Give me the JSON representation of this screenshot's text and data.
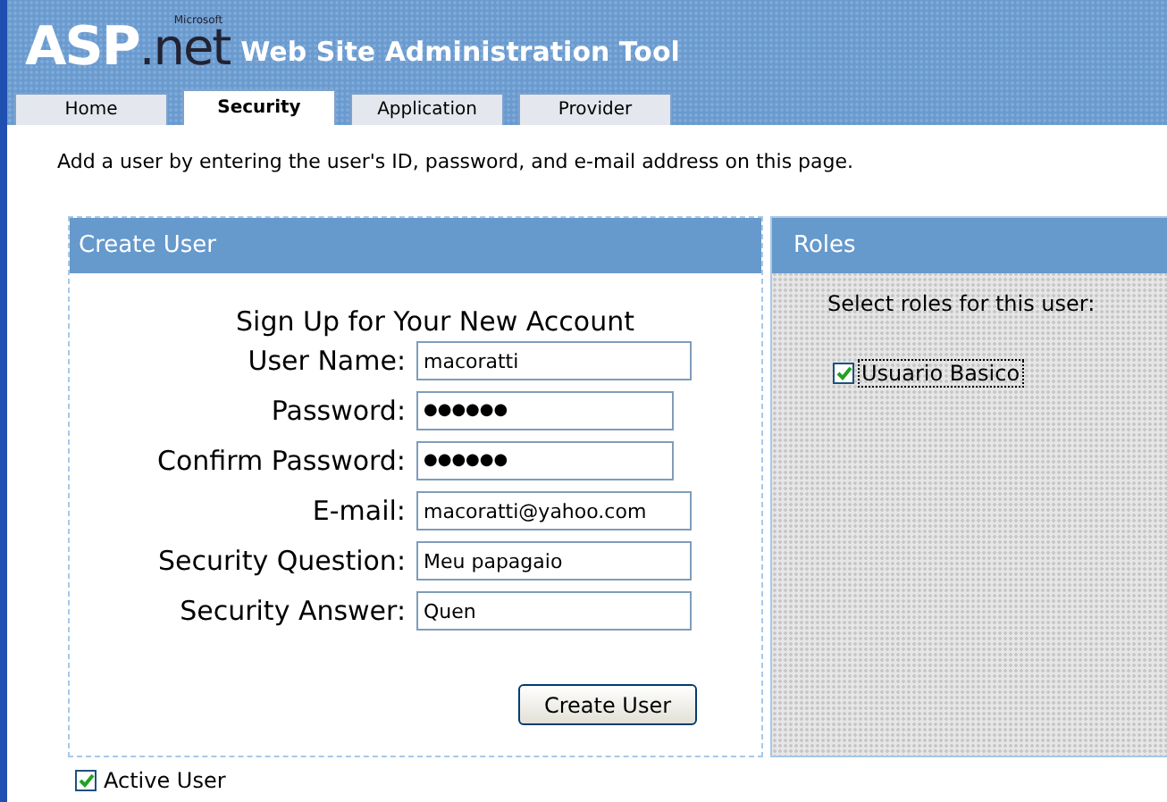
{
  "header": {
    "logo": {
      "main": "ASP",
      "maker": "Microsoft",
      "suffix": ".net"
    },
    "title": "Web Site Administration Tool"
  },
  "tabs": [
    {
      "label": "Home",
      "selected": false
    },
    {
      "label": "Security",
      "selected": true
    },
    {
      "label": "Application",
      "selected": false
    },
    {
      "label": "Provider",
      "selected": false
    }
  ],
  "intro": "Add a user by entering the user's ID, password, and e-mail address on this page.",
  "create_user": {
    "title": "Create User",
    "heading": "Sign Up for Your New Account",
    "fields": [
      {
        "label": "User Name:",
        "value": "macoratti",
        "kind": "text"
      },
      {
        "label": "Password:",
        "value": "●●●●●●",
        "kind": "password"
      },
      {
        "label": "Confirm Password:",
        "value": "●●●●●●",
        "kind": "password"
      },
      {
        "label": "E-mail:",
        "value": "macoratti@yahoo.com",
        "kind": "text"
      },
      {
        "label": "Security Question:",
        "value": "Meu papagaio",
        "kind": "text"
      },
      {
        "label": "Security Answer:",
        "value": "Quen",
        "kind": "text"
      }
    ],
    "button": "Create User"
  },
  "roles": {
    "title": "Roles",
    "prompt": "Select roles for this user:",
    "items": [
      {
        "label": "Usuario Basico",
        "checked": true
      }
    ]
  },
  "active_user": {
    "label": "Active User",
    "checked": true
  }
}
